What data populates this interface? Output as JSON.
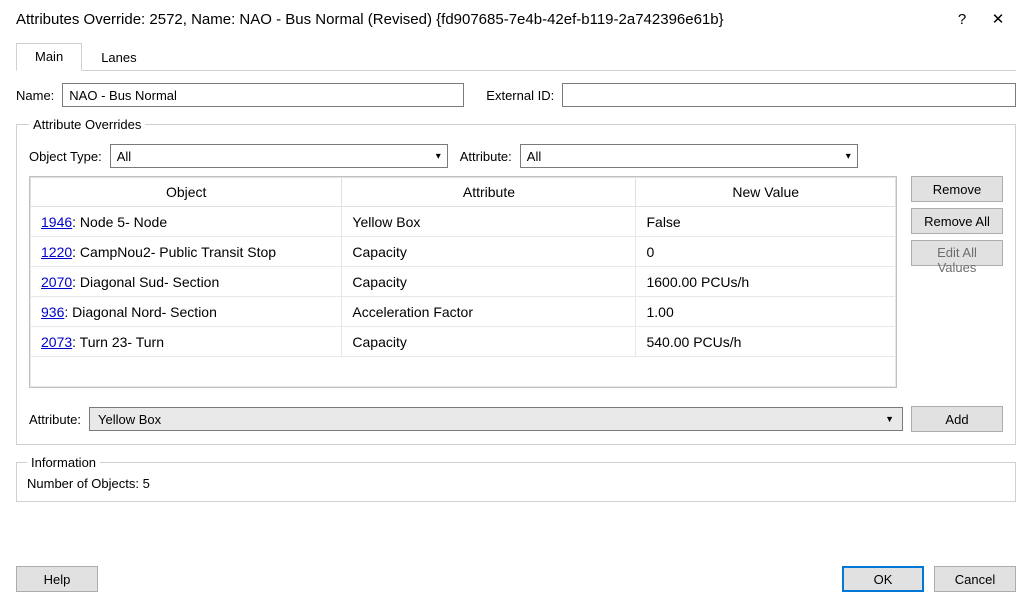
{
  "window": {
    "title": "Attributes Override: 2572, Name: NAO - Bus Normal (Revised)  {fd907685-7e4b-42ef-b119-2a742396e61b}",
    "help_glyph": "?",
    "close_glyph": "✕"
  },
  "tabs": [
    {
      "label": "Main",
      "active": true
    },
    {
      "label": "Lanes",
      "active": false
    }
  ],
  "labels": {
    "name": "Name:",
    "external_id": "External ID:",
    "group_overrides": "Attribute Overrides",
    "object_type": "Object Type:",
    "attribute": "Attribute:",
    "attr_bottom": "Attribute:",
    "information": "Information"
  },
  "fields": {
    "name": "NAO - Bus Normal",
    "external_id": ""
  },
  "filters": {
    "object_type_selected": "All",
    "attribute_selected": "All"
  },
  "table": {
    "headers": {
      "object": "Object",
      "attribute": "Attribute",
      "new_value": "New Value"
    },
    "rows": [
      {
        "id": "1946",
        "object_rest": ": Node 5- Node",
        "attribute": "Yellow Box",
        "value": "False"
      },
      {
        "id": "1220",
        "object_rest": ": CampNou2- Public Transit Stop",
        "attribute": "Capacity",
        "value": "0"
      },
      {
        "id": "2070",
        "object_rest": ": Diagonal Sud- Section",
        "attribute": "Capacity",
        "value": "1600.00 PCUs/h"
      },
      {
        "id": "936",
        "object_rest": ": Diagonal Nord- Section",
        "attribute": "Acceleration Factor",
        "value": "1.00"
      },
      {
        "id": "2073",
        "object_rest": ": Turn 23- Turn",
        "attribute": "Capacity",
        "value": "540.00 PCUs/h"
      }
    ]
  },
  "side_buttons": {
    "remove": "Remove",
    "remove_all": "Remove All",
    "edit_all": "Edit All Values"
  },
  "attribute_add": {
    "selected": "Yellow Box",
    "add": "Add"
  },
  "information": {
    "count_label": "Number of Objects: 5"
  },
  "footer": {
    "help": "Help",
    "ok": "OK",
    "cancel": "Cancel"
  }
}
